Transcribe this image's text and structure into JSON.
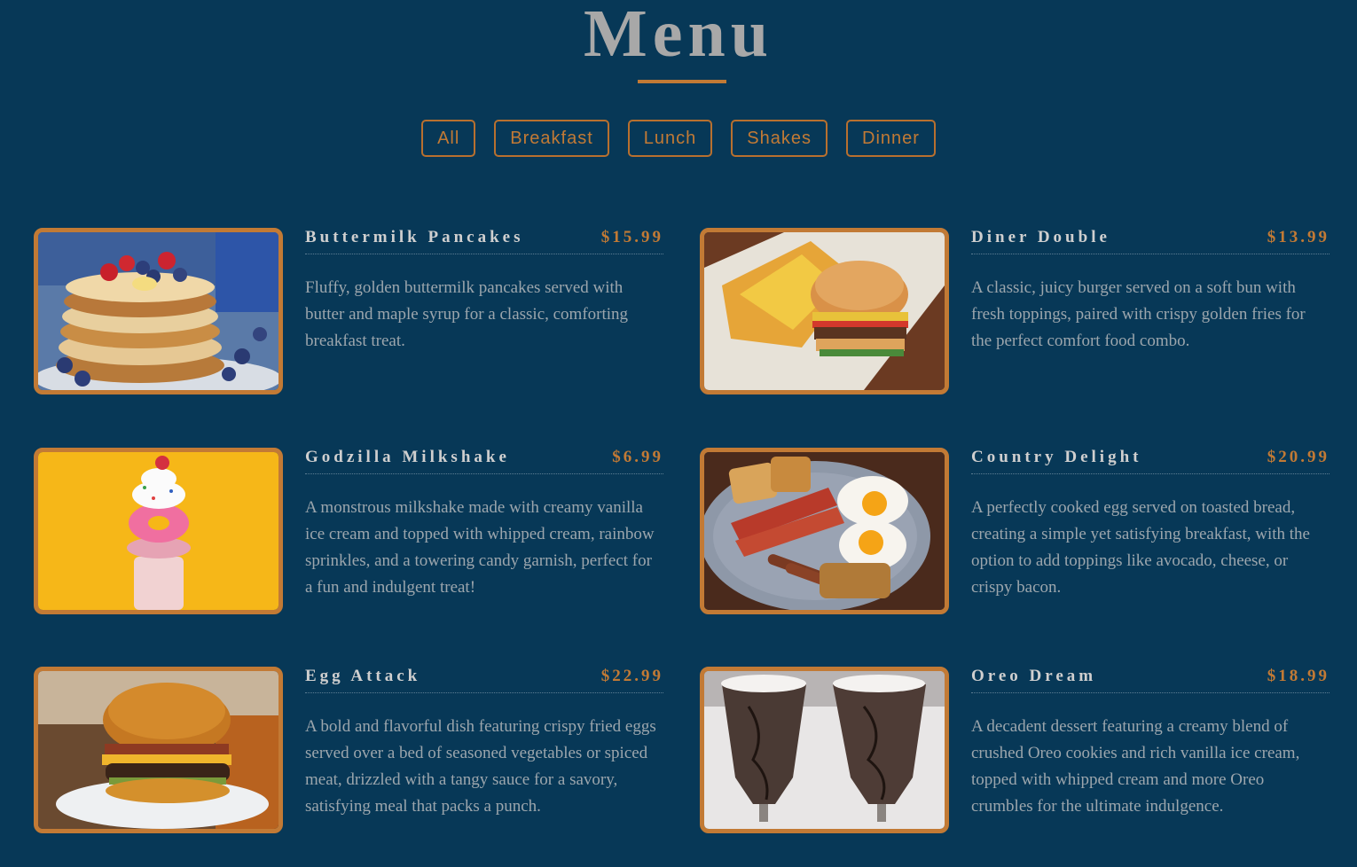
{
  "page": {
    "title": "Menu"
  },
  "colors": {
    "background": "#073857",
    "accent": "#c27a35",
    "heading": "#a8a8a8",
    "text": "#9ca6ad"
  },
  "filters": [
    "All",
    "Breakfast",
    "Lunch",
    "Shakes",
    "Dinner"
  ],
  "items": [
    {
      "name": "Buttermilk Pancakes",
      "price": "$15.99",
      "description": "Fluffy, golden buttermilk pancakes served with butter and maple syrup for a classic, comforting breakfast treat.",
      "image": "pancakes-photo"
    },
    {
      "name": "Diner Double",
      "price": "$13.99",
      "description": "A classic, juicy burger served on a soft bun with fresh toppings, paired with crispy golden fries for the perfect comfort food combo.",
      "image": "burger-fries-photo"
    },
    {
      "name": "Godzilla Milkshake",
      "price": "$6.99",
      "description": "A monstrous milkshake made with creamy vanilla ice cream and topped with whipped cream, rainbow sprinkles, and a towering candy garnish, perfect for a fun and indulgent treat!",
      "image": "milkshake-photo"
    },
    {
      "name": "Country Delight",
      "price": "$20.99",
      "description": "A perfectly cooked egg served on toasted bread, creating a simple yet satisfying breakfast, with the option to add toppings like avocado, cheese, or crispy bacon.",
      "image": "breakfast-plate-photo"
    },
    {
      "name": "Egg Attack",
      "price": "$22.99",
      "description": "A bold and flavorful dish featuring crispy fried eggs served over a bed of seasoned vegetables or spiced meat, drizzled with a tangy sauce for a savory, satisfying meal that packs a punch.",
      "image": "bacon-burger-photo"
    },
    {
      "name": "Oreo Dream",
      "price": "$18.99",
      "description": "A decadent dessert featuring a creamy blend of crushed Oreo cookies and rich vanilla ice cream, topped with whipped cream and more Oreo crumbles for the ultimate indulgence.",
      "image": "oreo-shakes-photo"
    }
  ]
}
